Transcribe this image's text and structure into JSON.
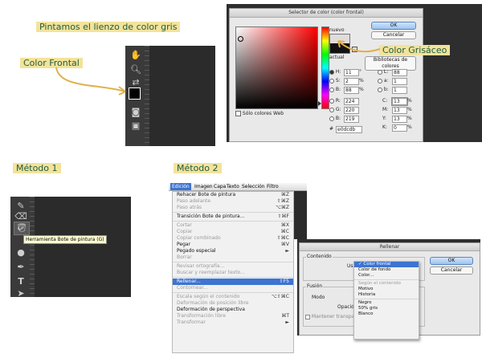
{
  "labels": {
    "title": "Pintamos el lienzo de color gris",
    "color_frontal": "Color Frontal",
    "color_grisaceo": "Color Grisáceo",
    "metodo1": "Método 1",
    "metodo2": "Método 2"
  },
  "color_picker": {
    "title": "Selector de color (color frontal)",
    "ok": "OK",
    "cancel": "Cancelar",
    "nuevo": "nuevo",
    "actual": "actual",
    "libraries": "Bibliotecas de colores",
    "web_only": "Sólo colores Web",
    "hsb": [
      {
        "label": "H:",
        "value": "11",
        "unit": "°"
      },
      {
        "label": "S:",
        "value": "2",
        "unit": "%"
      },
      {
        "label": "B:",
        "value": "88",
        "unit": "%"
      }
    ],
    "rgb": [
      {
        "label": "R:",
        "value": "224"
      },
      {
        "label": "G:",
        "value": "220"
      },
      {
        "label": "B:",
        "value": "219"
      }
    ],
    "lab": [
      {
        "label": "L:",
        "value": "88"
      },
      {
        "label": "a:",
        "value": "1"
      },
      {
        "label": "b:",
        "value": "1"
      }
    ],
    "cmyk": [
      {
        "label": "C:",
        "value": "13",
        "unit": "%"
      },
      {
        "label": "M:",
        "value": "13",
        "unit": "%"
      },
      {
        "label": "Y:",
        "value": "13",
        "unit": "%"
      },
      {
        "label": "K:",
        "value": "0",
        "unit": "%"
      }
    ],
    "hex_label": "#",
    "hex": "e0dcdb",
    "new_color": "#e0dcdb",
    "current_color": "#111111"
  },
  "tooltip": "Herramienta Bote de pintura (G)",
  "menubar": [
    "Edición",
    "Imagen",
    "Capa",
    "Texto",
    "Selección",
    "Filtro"
  ],
  "edit_menu": [
    {
      "label": "Rehacer Bote de pintura",
      "shortcut": "⌘Z",
      "state": "normal"
    },
    {
      "label": "Paso adelante",
      "shortcut": "⇧⌘Z",
      "state": "disabled"
    },
    {
      "label": "Paso atrás",
      "shortcut": "⌥⌘Z",
      "state": "disabled"
    },
    {
      "sep": true
    },
    {
      "label": "Transición Bote de pintura...",
      "shortcut": "⇧⌘F",
      "state": "normal"
    },
    {
      "sep": true
    },
    {
      "label": "Cortar",
      "shortcut": "⌘X",
      "state": "disabled"
    },
    {
      "label": "Copiar",
      "shortcut": "⌘C",
      "state": "disabled"
    },
    {
      "label": "Copiar combinado",
      "shortcut": "⇧⌘C",
      "state": "disabled"
    },
    {
      "label": "Pegar",
      "shortcut": "⌘V",
      "state": "normal"
    },
    {
      "label": "Pegado especial",
      "shortcut": "►",
      "state": "normal"
    },
    {
      "label": "Borrar",
      "shortcut": "",
      "state": "disabled"
    },
    {
      "sep": true
    },
    {
      "label": "Revisar ortografía...",
      "shortcut": "",
      "state": "disabled"
    },
    {
      "label": "Buscar y reemplazar texto...",
      "shortcut": "",
      "state": "disabled"
    },
    {
      "sep": true
    },
    {
      "label": "Rellenar...",
      "shortcut": "⇧F5",
      "state": "selected"
    },
    {
      "label": "Contornear...",
      "shortcut": "",
      "state": "disabled"
    },
    {
      "sep": true
    },
    {
      "label": "Escala según el contenido",
      "shortcut": "⌥⇧⌘C",
      "state": "disabled"
    },
    {
      "label": "Deformación de posición libre",
      "shortcut": "",
      "state": "disabled"
    },
    {
      "label": "Deformación de perspectiva",
      "shortcut": "",
      "state": "normal"
    },
    {
      "label": "Transformación libre",
      "shortcut": "⌘T",
      "state": "disabled"
    },
    {
      "label": "Transformar",
      "shortcut": "►",
      "state": "disabled"
    }
  ],
  "fill_dialog": {
    "title": "Rellenar",
    "ok": "OK",
    "cancel": "Cancelar",
    "contenido": "Contenido",
    "usar_label": "Usar",
    "fusion": "Fusión",
    "modo": "Modo",
    "opacidad": "Opacidad",
    "mantener": "Mantener transparencia",
    "options": [
      {
        "label": "✓ Color frontal",
        "state": "selected"
      },
      {
        "label": "Color de fondo",
        "state": "normal"
      },
      {
        "label": "Color...",
        "state": "normal"
      },
      {
        "sep": true
      },
      {
        "label": "Según el contenido",
        "state": "disabled"
      },
      {
        "label": "Motivo",
        "state": "normal"
      },
      {
        "label": "Historia",
        "state": "normal"
      },
      {
        "sep": true
      },
      {
        "label": "Negro",
        "state": "normal"
      },
      {
        "label": "50% gris",
        "state": "normal"
      },
      {
        "label": "Blanco",
        "state": "normal"
      }
    ]
  },
  "colors": {
    "label_bg": "#f3e39a",
    "label_text": "#1d5c45",
    "arrow": "#e0b04a",
    "highlight": "#3d74d1",
    "panel": "#2b2b2b"
  }
}
